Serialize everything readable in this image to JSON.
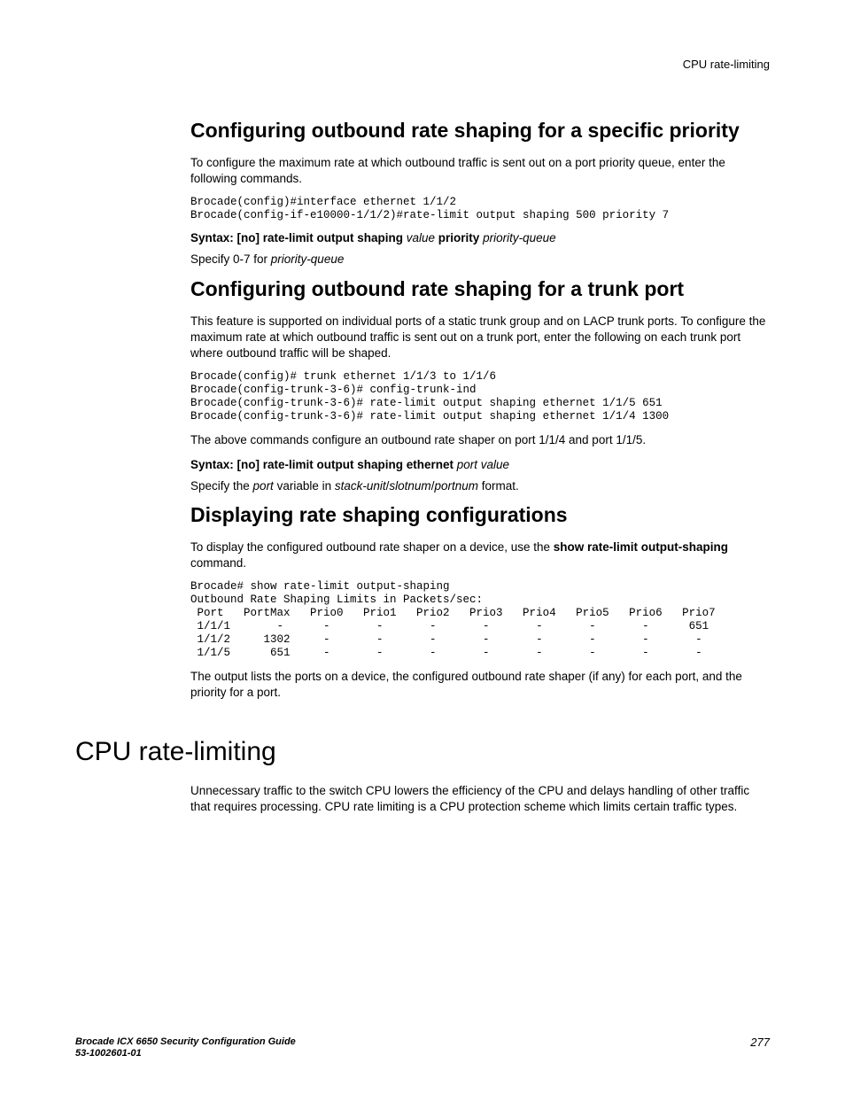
{
  "header": {
    "running": "CPU rate-limiting"
  },
  "sec1": {
    "title": "Configuring outbound rate shaping for a specific priority",
    "intro": "To configure the maximum rate at which outbound traffic is sent out on a port priority queue, enter the following commands.",
    "code": "Brocade(config)#interface ethernet 1/1/2\nBrocade(config-if-e10000-1/1/2)#rate-limit output shaping 500 priority 7",
    "syntax": {
      "prefix": "Syntax:  ",
      "part1": "[no] rate-limit output shaping",
      "value": " value ",
      "part2": "priority",
      "pq": " priority-queue"
    },
    "note_pre": "Specify 0-7 for ",
    "note_it": "priority-queue"
  },
  "sec2": {
    "title": "Configuring outbound rate shaping for a trunk port",
    "intro": "This feature is supported on individual ports of a static trunk group and on LACP trunk ports. To configure the maximum rate at which outbound traffic is sent out on a trunk port, enter the following on each trunk port where outbound traffic will be shaped.",
    "code": "Brocade(config)# trunk ethernet 1/1/3 to 1/1/6\nBrocade(config-trunk-3-6)# config-trunk-ind\nBrocade(config-trunk-3-6)# rate-limit output shaping ethernet 1/1/5 651\nBrocade(config-trunk-3-6)# rate-limit output shaping ethernet 1/1/4 1300",
    "after": "The above commands configure an outbound rate shaper on port 1/1/4 and port 1/1/5.",
    "syntax": {
      "prefix": "Syntax:  ",
      "part1": "[no] rate-limit output shaping ethernet",
      "pv": " port value"
    },
    "note1": "Specify the ",
    "note_it1": "port",
    "note2": " variable in ",
    "note_it2": "stack-unit",
    "slash1": "/",
    "note_it3": "slotnum",
    "slash2": "/",
    "note_it4": "portnum",
    "note3": " format."
  },
  "sec3": {
    "title": "Displaying rate shaping configurations",
    "intro_pre": "To display the configured outbound rate shaper on a device, use the ",
    "intro_bold": "show rate-limit output-shaping",
    "intro_post": " command.",
    "code": "Brocade# show rate-limit output-shaping\nOutbound Rate Shaping Limits in Packets/sec:\n Port   PortMax   Prio0   Prio1   Prio2   Prio3   Prio4   Prio5   Prio6   Prio7\n 1/1/1       -      -       -       -       -       -       -       -      651\n 1/1/2     1302     -       -       -       -       -       -       -       -\n 1/1/5      651     -       -       -       -       -       -       -       -",
    "after": "The output lists the ports on a device, the configured outbound rate shaper (if any) for each port, and the priority for a port."
  },
  "chapter": {
    "title": "CPU rate-limiting",
    "body": "Unnecessary traffic to the switch CPU lowers the efficiency of the CPU and delays handling of other traffic that requires processing. CPU rate limiting is a CPU protection scheme which limits certain traffic types."
  },
  "footer": {
    "line1": "Brocade ICX 6650 Security Configuration Guide",
    "line2": "53-1002601-01",
    "page": "277"
  }
}
